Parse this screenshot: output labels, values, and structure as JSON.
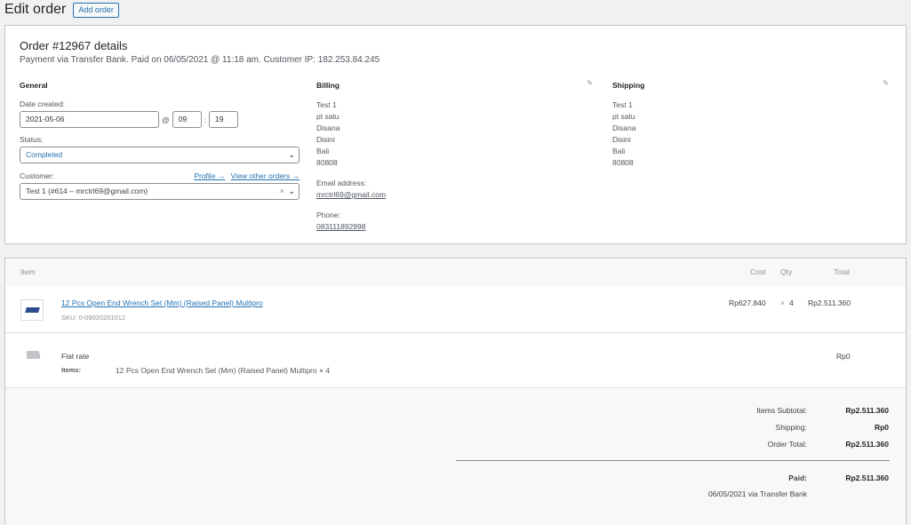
{
  "header": {
    "title": "Edit order",
    "add_button": "Add order"
  },
  "order": {
    "heading": "Order #12967 details",
    "meta": "Payment via Transfer Bank. Paid on 06/05/2021 @ 11:18 am. Customer IP: 182.253.84.245"
  },
  "general": {
    "title": "General",
    "date_label": "Date created:",
    "date_value": "2021-05-06",
    "at_sign": "@",
    "hour": "09",
    "colon": ":",
    "minute": "19",
    "status_label": "Status:",
    "status_value": "Completed",
    "customer_label": "Customer:",
    "profile_link": "Profile →",
    "view_orders_link": "View other orders →",
    "customer_value": "Test 1 (#614 – mrctrl69@gmail.com)"
  },
  "billing": {
    "title": "Billing",
    "address": [
      "Test 1",
      "pt satu",
      "Disana",
      "Disini",
      "Bali",
      "80808"
    ],
    "email_label": "Email address:",
    "email": "mrctrl69@gmail.com",
    "phone_label": "Phone:",
    "phone": "083111892898"
  },
  "shipping": {
    "title": "Shipping",
    "address": [
      "Test 1",
      "pt satu",
      "Disana",
      "Disini",
      "Bali",
      "80808"
    ]
  },
  "items": {
    "headers": {
      "item": "Item",
      "cost": "Cost",
      "qty": "Qty",
      "total": "Total"
    },
    "rows": [
      {
        "name": "12 Pcs Open End Wrench Set (Mm) (Raised Panel) Multipro",
        "sku": "SKU: 0-09020201012",
        "cost": "Rp627.840",
        "qty_x": "×",
        "qty": "4",
        "total": "Rp2.511.360"
      }
    ],
    "shipping": {
      "name": "Flat rate",
      "items_label": "Items:",
      "items_value": "12 Pcs Open End Wrench Set (Mm) (Raised Panel) Multipro × 4",
      "total": "Rp0"
    }
  },
  "totals": {
    "subtotal_label": "Items Subtotal:",
    "subtotal": "Rp2.511.360",
    "shipping_label": "Shipping:",
    "shipping": "Rp0",
    "order_total_label": "Order Total:",
    "order_total": "Rp2.511.360",
    "paid_label": "Paid:",
    "paid": "Rp2.511.360",
    "paid_note": "06/05/2021 via Transfer Bank"
  },
  "colors": {
    "link": "#2271b1",
    "border": "#c3c4c7",
    "background": "#f1f1f1"
  }
}
